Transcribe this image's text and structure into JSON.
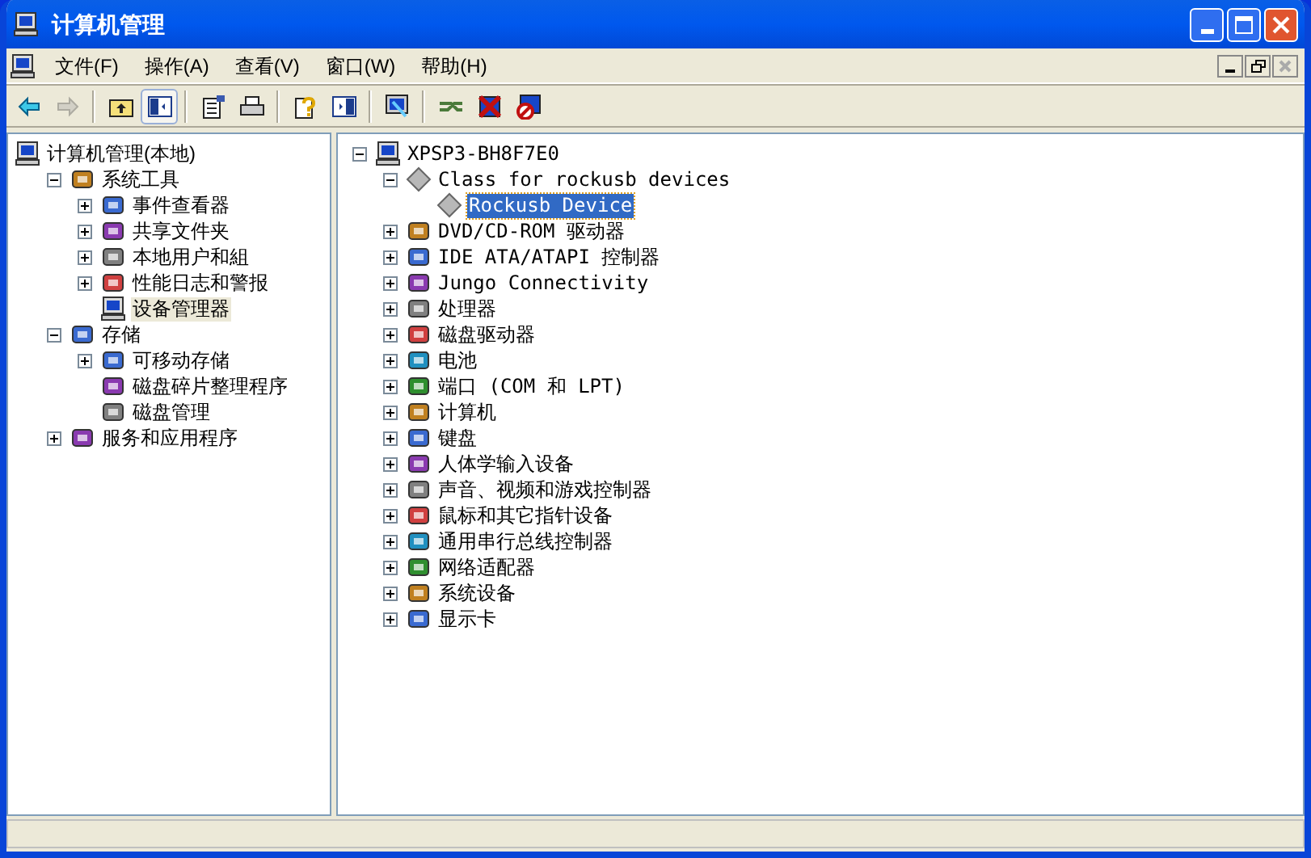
{
  "window": {
    "title": "计算机管理"
  },
  "menu": [
    {
      "label": "文件(F)"
    },
    {
      "label": "操作(A)"
    },
    {
      "label": "查看(V)"
    },
    {
      "label": "窗口(W)"
    },
    {
      "label": "帮助(H)"
    }
  ],
  "toolbar": [
    {
      "kind": "back",
      "disabled": false,
      "pressed": false
    },
    {
      "kind": "forward",
      "disabled": true,
      "pressed": false
    },
    {
      "kind": "separator"
    },
    {
      "kind": "up",
      "disabled": false,
      "pressed": false
    },
    {
      "kind": "tree",
      "disabled": false,
      "pressed": true
    },
    {
      "kind": "separator"
    },
    {
      "kind": "properties",
      "disabled": false,
      "pressed": false
    },
    {
      "kind": "print",
      "disabled": false,
      "pressed": false
    },
    {
      "kind": "separator"
    },
    {
      "kind": "help",
      "disabled": false,
      "pressed": false
    },
    {
      "kind": "panel",
      "disabled": false,
      "pressed": false
    },
    {
      "kind": "separator"
    },
    {
      "kind": "scan",
      "disabled": false,
      "pressed": false
    },
    {
      "kind": "separator"
    },
    {
      "kind": "update",
      "disabled": false,
      "pressed": false
    },
    {
      "kind": "uninstall",
      "disabled": false,
      "pressed": false
    },
    {
      "kind": "disable",
      "disabled": false,
      "pressed": false
    }
  ],
  "left_tree": [
    {
      "label": "计算机管理(本地)",
      "selected": false,
      "children": [
        {
          "label": "系统工具",
          "expanded": true,
          "selected": false,
          "children": [
            {
              "label": "事件查看器",
              "expanded": false,
              "selected": false
            },
            {
              "label": "共享文件夹",
              "expanded": false,
              "selected": false
            },
            {
              "label": "本地用户和組",
              "expanded": false,
              "selected": false
            },
            {
              "label": "性能日志和警报",
              "expanded": false,
              "selected": false
            },
            {
              "label": "设备管理器",
              "selected": true
            }
          ]
        },
        {
          "label": "存储",
          "expanded": true,
          "selected": false,
          "children": [
            {
              "label": "可移动存储",
              "expanded": false,
              "selected": false
            },
            {
              "label": "磁盘碎片整理程序",
              "selected": false
            },
            {
              "label": "磁盘管理",
              "selected": false
            }
          ]
        },
        {
          "label": "服务和应用程序",
          "expanded": false,
          "selected": false
        }
      ]
    }
  ],
  "right_tree": [
    {
      "label": "XPSP3-BH8F7E0",
      "expanded": true,
      "selected": false,
      "children": [
        {
          "label": "Class for rockusb devices",
          "expanded": true,
          "selected": false,
          "children": [
            {
              "label": "Rockusb Device",
              "selected": true
            }
          ]
        },
        {
          "label": "DVD/CD-ROM 驱动器",
          "expanded": false,
          "selected": false
        },
        {
          "label": "IDE ATA/ATAPI 控制器",
          "expanded": false,
          "selected": false
        },
        {
          "label": "Jungo Connectivity",
          "expanded": false,
          "selected": false
        },
        {
          "label": "处理器",
          "expanded": false,
          "selected": false
        },
        {
          "label": "磁盘驱动器",
          "expanded": false,
          "selected": false
        },
        {
          "label": "电池",
          "expanded": false,
          "selected": false
        },
        {
          "label": "端口 (COM 和 LPT)",
          "expanded": false,
          "selected": false
        },
        {
          "label": "计算机",
          "expanded": false,
          "selected": false
        },
        {
          "label": "键盘",
          "expanded": false,
          "selected": false
        },
        {
          "label": "人体学输入设备",
          "expanded": false,
          "selected": false
        },
        {
          "label": "声音、视频和游戏控制器",
          "expanded": false,
          "selected": false
        },
        {
          "label": "鼠标和其它指针设备",
          "expanded": false,
          "selected": false
        },
        {
          "label": "通用串行总线控制器",
          "expanded": false,
          "selected": false
        },
        {
          "label": "网络适配器",
          "expanded": false,
          "selected": false
        },
        {
          "label": "系统设备",
          "expanded": false,
          "selected": false
        },
        {
          "label": "显示卡",
          "expanded": false,
          "selected": false
        }
      ]
    }
  ]
}
